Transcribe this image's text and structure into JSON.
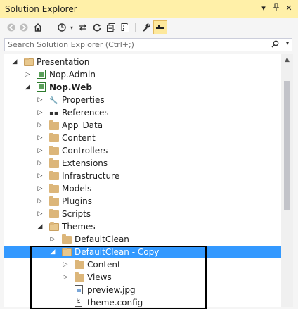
{
  "window": {
    "title": "Solution Explorer",
    "pin_glyph": "▾",
    "autohide_glyph": "ᵖ",
    "close_glyph": "✕"
  },
  "toolbar": {
    "back_glyph": "◀",
    "forward_glyph": "▶",
    "home_glyph": "⌂",
    "history_glyph": "◔",
    "dropdown_glyph": "▾",
    "sync_glyph": "⇄",
    "refresh_glyph": "↻",
    "collapse_glyph": "⊟",
    "showall_glyph": "⧉",
    "properties_glyph": "🔧",
    "preview_glyph": "▬"
  },
  "search": {
    "placeholder": "Search Solution Explorer (Ctrl+;)",
    "icon_glyph": "⚲",
    "drop_glyph": "▾"
  },
  "tree": {
    "items": [
      {
        "label": "Presentation",
        "arrow": "◢",
        "icon": "folder-open-icon"
      },
      {
        "label": "Nop.Admin",
        "arrow": "▷",
        "icon": "project-icon"
      },
      {
        "label": "Nop.Web",
        "arrow": "◢",
        "icon": "project-icon"
      },
      {
        "label": "Properties",
        "arrow": "▷",
        "icon": "wrench-icon",
        "glyph": "🔧"
      },
      {
        "label": "References",
        "arrow": "▷",
        "icon": "references-icon",
        "glyph": "▪▪"
      },
      {
        "label": "App_Data",
        "arrow": "▷",
        "icon": "folder-icon"
      },
      {
        "label": "Content",
        "arrow": "▷",
        "icon": "folder-icon"
      },
      {
        "label": "Controllers",
        "arrow": "▷",
        "icon": "folder-icon"
      },
      {
        "label": "Extensions",
        "arrow": "▷",
        "icon": "folder-icon"
      },
      {
        "label": "Infrastructure",
        "arrow": "▷",
        "icon": "folder-icon"
      },
      {
        "label": "Models",
        "arrow": "▷",
        "icon": "folder-icon"
      },
      {
        "label": "Plugins",
        "arrow": "▷",
        "icon": "folder-icon"
      },
      {
        "label": "Scripts",
        "arrow": "▷",
        "icon": "folder-icon"
      },
      {
        "label": "Themes",
        "arrow": "◢",
        "icon": "folder-open-icon"
      },
      {
        "label": "DefaultClean",
        "arrow": "▷",
        "icon": "folder-icon"
      },
      {
        "label": "DefaultClean - Copy",
        "arrow": "◢",
        "icon": "folder-open-icon"
      },
      {
        "label": "Content",
        "arrow": "▷",
        "icon": "folder-icon"
      },
      {
        "label": "Views",
        "arrow": "▷",
        "icon": "folder-icon"
      },
      {
        "label": "preview.jpg",
        "arrow": "",
        "icon": "image-file-icon"
      },
      {
        "label": "theme.config",
        "arrow": "",
        "icon": "config-file-icon",
        "glyph": "↯"
      }
    ]
  },
  "scrollbar": {
    "up_glyph": "▲"
  }
}
